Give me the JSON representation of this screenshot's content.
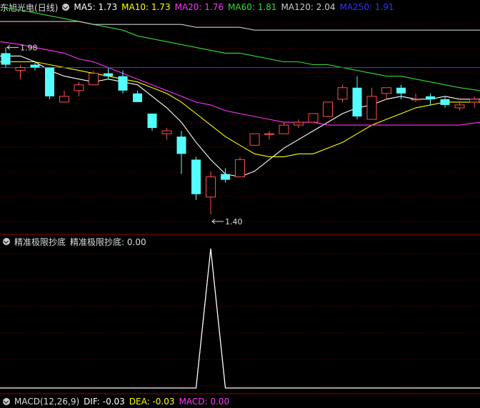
{
  "colors": {
    "up": "#ff4d4d",
    "down": "#54ffff",
    "ma5": "#ffffff",
    "ma10": "#ffff00",
    "ma20": "#ff33ff",
    "ma60": "#33dd33",
    "ma120": "#cccccc",
    "ma250": "#3333ff",
    "grid": "#8b0000",
    "signal": "#ffffff"
  },
  "header": {
    "stock": "东旭光电",
    "period": "(日线)",
    "ma5_label": "MA5: 1.73",
    "ma10_label": "MA10: 1.73",
    "ma20_label": "MA20: 1.76",
    "ma60_label": "MA60: 1.81",
    "ma120_label": "MA120: 2.04",
    "ma250_label": "MA250: 1.91"
  },
  "indicator": {
    "name": "精准极限抄底",
    "value_label": "精准极限抄底: 0.00"
  },
  "macd_bar": {
    "name": "MACD(12,26,9)",
    "dif": "DIF: -0.03",
    "dea": "DEA: -0.03",
    "macd": "MACD: 0.00"
  },
  "chart_data": [
    {
      "type": "candlestick",
      "price_range": [
        1.36,
        2.12
      ],
      "annotations": [
        {
          "text": "1.98",
          "candle": 0
        },
        {
          "text": "1.40",
          "candle": 14
        }
      ],
      "candles": [
        {
          "o": 1.96,
          "h": 1.98,
          "l": 1.91,
          "c": 1.92
        },
        {
          "o": 1.9,
          "h": 1.92,
          "l": 1.87,
          "c": 1.91
        },
        {
          "o": 1.92,
          "h": 1.93,
          "l": 1.9,
          "c": 1.91
        },
        {
          "o": 1.91,
          "h": 1.91,
          "l": 1.8,
          "c": 1.81
        },
        {
          "o": 1.79,
          "h": 1.83,
          "l": 1.79,
          "c": 1.81
        },
        {
          "o": 1.83,
          "h": 1.86,
          "l": 1.81,
          "c": 1.85
        },
        {
          "o": 1.85,
          "h": 1.9,
          "l": 1.85,
          "c": 1.89
        },
        {
          "o": 1.89,
          "h": 1.91,
          "l": 1.87,
          "c": 1.88
        },
        {
          "o": 1.88,
          "h": 1.9,
          "l": 1.82,
          "c": 1.83
        },
        {
          "o": 1.82,
          "h": 1.83,
          "l": 1.79,
          "c": 1.79
        },
        {
          "o": 1.75,
          "h": 1.75,
          "l": 1.69,
          "c": 1.7
        },
        {
          "o": 1.68,
          "h": 1.7,
          "l": 1.66,
          "c": 1.69
        },
        {
          "o": 1.67,
          "h": 1.69,
          "l": 1.54,
          "c": 1.61
        },
        {
          "o": 1.59,
          "h": 1.6,
          "l": 1.45,
          "c": 1.47
        },
        {
          "o": 1.46,
          "h": 1.55,
          "l": 1.4,
          "c": 1.53
        },
        {
          "o": 1.54,
          "h": 1.56,
          "l": 1.51,
          "c": 1.52
        },
        {
          "o": 1.53,
          "h": 1.6,
          "l": 1.53,
          "c": 1.59
        },
        {
          "o": 1.64,
          "h": 1.68,
          "l": 1.64,
          "c": 1.68
        },
        {
          "o": 1.68,
          "h": 1.69,
          "l": 1.66,
          "c": 1.68
        },
        {
          "o": 1.68,
          "h": 1.72,
          "l": 1.68,
          "c": 1.71
        },
        {
          "o": 1.71,
          "h": 1.73,
          "l": 1.7,
          "c": 1.72
        },
        {
          "o": 1.72,
          "h": 1.75,
          "l": 1.72,
          "c": 1.75
        },
        {
          "o": 1.74,
          "h": 1.79,
          "l": 1.74,
          "c": 1.79
        },
        {
          "o": 1.8,
          "h": 1.85,
          "l": 1.79,
          "c": 1.84
        },
        {
          "o": 1.84,
          "h": 1.88,
          "l": 1.73,
          "c": 1.74
        },
        {
          "o": 1.73,
          "h": 1.84,
          "l": 1.73,
          "c": 1.81
        },
        {
          "o": 1.82,
          "h": 1.84,
          "l": 1.8,
          "c": 1.84
        },
        {
          "o": 1.84,
          "h": 1.85,
          "l": 1.8,
          "c": 1.82
        },
        {
          "o": 1.8,
          "h": 1.82,
          "l": 1.79,
          "c": 1.8
        },
        {
          "o": 1.81,
          "h": 1.82,
          "l": 1.78,
          "c": 1.8
        },
        {
          "o": 1.8,
          "h": 1.81,
          "l": 1.77,
          "c": 1.78
        },
        {
          "o": 1.77,
          "h": 1.79,
          "l": 1.76,
          "c": 1.78
        },
        {
          "o": 1.79,
          "h": 1.81,
          "l": 1.77,
          "c": 1.8
        }
      ],
      "series": [
        {
          "name": "MA5",
          "values": [
            1.95,
            1.95,
            1.93,
            1.9,
            1.88,
            1.87,
            1.86,
            1.87,
            1.86,
            1.85,
            1.81,
            1.77,
            1.72,
            1.65,
            1.59,
            1.54,
            1.53,
            1.55,
            1.59,
            1.63,
            1.66,
            1.69,
            1.72,
            1.75,
            1.77,
            1.78,
            1.8,
            1.81,
            1.8,
            1.8,
            1.81,
            1.8,
            1.8
          ]
        },
        {
          "name": "MA10",
          "values": [
            1.93,
            1.93,
            1.93,
            1.92,
            1.91,
            1.9,
            1.89,
            1.88,
            1.87,
            1.86,
            1.84,
            1.82,
            1.79,
            1.75,
            1.71,
            1.67,
            1.64,
            1.61,
            1.6,
            1.6,
            1.61,
            1.61,
            1.63,
            1.65,
            1.68,
            1.71,
            1.73,
            1.75,
            1.77,
            1.78,
            1.79,
            1.79,
            1.79
          ]
        },
        {
          "name": "MA20",
          "values": [
            2.0,
            1.99,
            1.98,
            1.97,
            1.96,
            1.94,
            1.93,
            1.91,
            1.89,
            1.87,
            1.85,
            1.83,
            1.81,
            1.79,
            1.78,
            1.76,
            1.75,
            1.74,
            1.73,
            1.72,
            1.72,
            1.72,
            1.71,
            1.71,
            1.71,
            1.71,
            1.71,
            1.71,
            1.71,
            1.71,
            1.71,
            1.71,
            1.72
          ]
        },
        {
          "name": "MA60",
          "values": [
            2.12,
            2.11,
            2.1,
            2.09,
            2.08,
            2.07,
            2.06,
            2.05,
            2.04,
            2.02,
            2.01,
            2.0,
            1.99,
            1.98,
            1.97,
            1.96,
            1.96,
            1.95,
            1.94,
            1.93,
            1.93,
            1.92,
            1.92,
            1.91,
            1.9,
            1.89,
            1.88,
            1.88,
            1.87,
            1.86,
            1.85,
            1.84,
            1.83
          ]
        },
        {
          "name": "MA120",
          "values": [
            2.07,
            2.07,
            2.07,
            2.07,
            2.07,
            2.07,
            2.06,
            2.06,
            2.06,
            2.06,
            2.06,
            2.06,
            2.06,
            2.05,
            2.05,
            2.05,
            2.05,
            2.04,
            2.04,
            2.04,
            2.04,
            2.04,
            2.04,
            2.04,
            2.04,
            2.04,
            2.04,
            2.04,
            2.04,
            2.04,
            2.04,
            2.04,
            2.04
          ]
        },
        {
          "name": "MA250",
          "values": [
            1.91,
            1.91,
            1.91,
            1.91,
            1.91,
            1.91,
            1.91,
            1.91,
            1.91,
            1.91,
            1.91,
            1.91,
            1.91,
            1.91,
            1.91,
            1.91,
            1.91,
            1.91,
            1.91,
            1.91,
            1.91,
            1.91,
            1.91,
            1.91,
            1.91,
            1.91,
            1.91,
            1.91,
            1.91,
            1.91,
            1.91,
            1.91,
            1.91
          ]
        }
      ]
    },
    {
      "type": "line",
      "name": "精准极限抄底",
      "ylim": [
        0,
        1
      ],
      "values": [
        0,
        0,
        0,
        0,
        0,
        0,
        0,
        0,
        0,
        0,
        0,
        0,
        0,
        0,
        1,
        0,
        0,
        0,
        0,
        0,
        0,
        0,
        0,
        0,
        0,
        0,
        0,
        0,
        0,
        0,
        0,
        0,
        0
      ]
    }
  ]
}
